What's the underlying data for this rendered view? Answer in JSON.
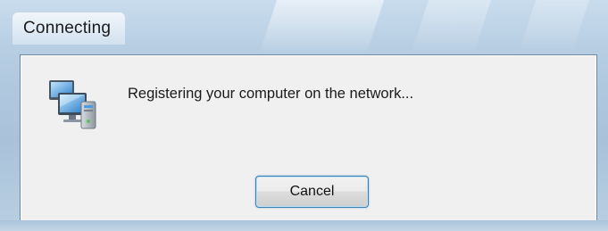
{
  "window": {
    "title": "Connecting"
  },
  "dialog": {
    "icon": "network-computers-icon",
    "message": "Registering your computer on the network...",
    "cancel_label": "Cancel"
  },
  "colors": {
    "accent_border": "#3c7fb1",
    "client_background": "#f0f0f0",
    "frame": "#b6cde2"
  }
}
